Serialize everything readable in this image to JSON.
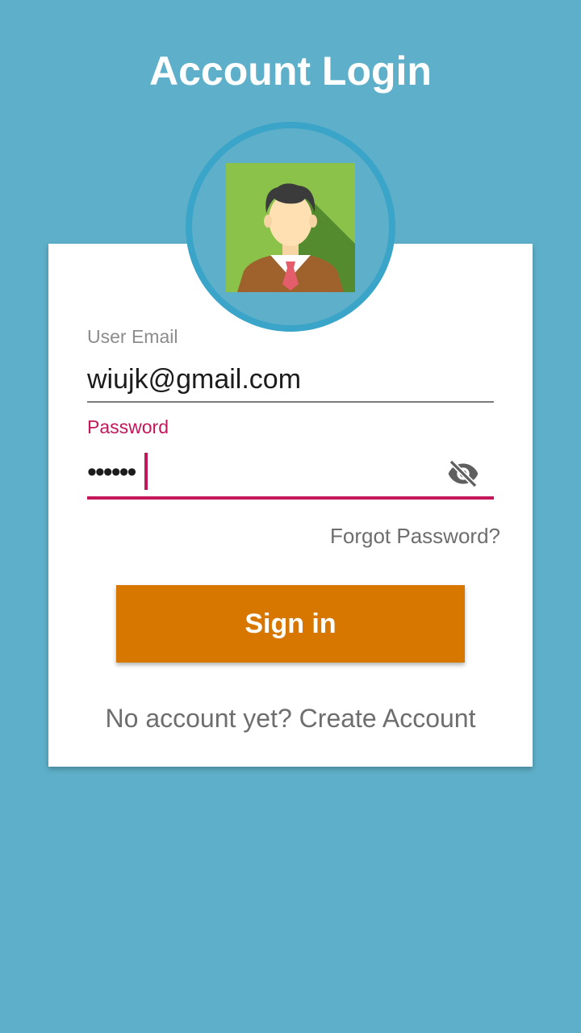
{
  "header": {
    "title": "Account Login"
  },
  "avatar": {
    "icon": "user-avatar-icon"
  },
  "form": {
    "email_label": "User Email",
    "email_value": "wiujk@gmail.com",
    "password_label": "Password",
    "password_value": "••••••",
    "visibility_icon": "eye-off-icon",
    "forgot_password": "Forgot Password?",
    "signin_label": "Sign in",
    "no_account_text": "No account yet?",
    "create_account_link": "Create Account"
  },
  "colors": {
    "background": "#5eafc9",
    "avatar_ring": "#3aa5c8",
    "accent": "#c2185b",
    "button": "#d87700",
    "card": "#ffffff"
  }
}
